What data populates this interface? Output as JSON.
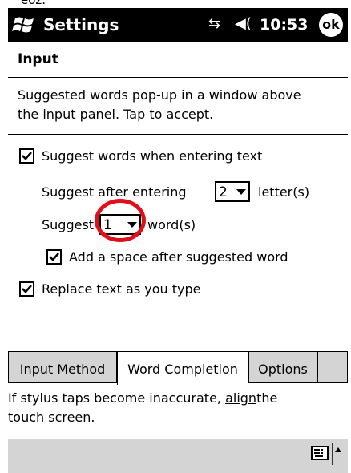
{
  "top_caption": "ёoz.",
  "titlebar": {
    "title": "Settings",
    "time": "10:53",
    "ok_label": "ok",
    "icons": [
      "windows-logo-icon",
      "connectivity-icon",
      "speaker-icon"
    ]
  },
  "page": {
    "heading": "Input",
    "description_line1": "Suggested words pop-up in a window above",
    "description_line2": "the input panel.  Tap to accept."
  },
  "options": {
    "suggest_words": {
      "label": "Suggest words when entering text",
      "checked": true
    },
    "suggest_after_prefix": "Suggest after entering",
    "suggest_after_value": "2",
    "suggest_after_suffix": "letter(s)",
    "suggest_count_prefix": "Suggest",
    "suggest_count_value": "1",
    "suggest_count_suffix": "word(s)",
    "add_space": {
      "label": "Add a space after suggested word",
      "checked": true
    },
    "replace_text": {
      "label": "Replace text as you type",
      "checked": true
    }
  },
  "tabs": [
    {
      "label": "Input Method",
      "active": false
    },
    {
      "label": "Word Completion",
      "active": true
    },
    {
      "label": "Options",
      "active": false
    }
  ],
  "help": {
    "line1_prefix": "If stylus taps become inaccurate, ",
    "link": "align",
    "line1_suffix": "the",
    "line2": "touch screen."
  },
  "colors": {
    "titlebar_bg": "#000000",
    "highlight_ring": "#e0101a",
    "tab_bg": "#d4d4d4"
  }
}
